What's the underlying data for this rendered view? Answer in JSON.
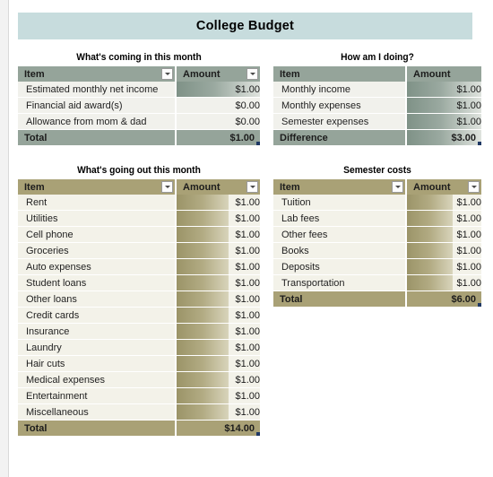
{
  "page": {
    "title": "College Budget",
    "theme_sage": "#95a49a",
    "theme_khaki": "#a9a176",
    "banner_color": "#c7dcdd"
  },
  "tables": {
    "incoming": {
      "heading": "What's coming in this month",
      "columns": [
        "Item",
        "Amount"
      ],
      "has_filters": true,
      "theme": "sage",
      "rows": [
        {
          "item": "Estimated monthly net income",
          "amount": "$1.00",
          "bar": 100
        },
        {
          "item": "Financial aid award(s)",
          "amount": "$0.00",
          "bar": 0
        },
        {
          "item": "Allowance from mom & dad",
          "amount": "$0.00",
          "bar": 0
        }
      ],
      "total_label": "Total",
      "total_amount": "$1.00"
    },
    "status": {
      "heading": "How am I doing?",
      "columns": [
        "Item",
        "Amount"
      ],
      "has_filters": false,
      "theme": "sage",
      "rows": [
        {
          "item": "Monthly income",
          "amount": "$1.00",
          "bar": 100
        },
        {
          "item": "Monthly expenses",
          "amount": "$1.00",
          "bar": 100
        },
        {
          "item": "Semester expenses",
          "amount": "$1.00",
          "bar": 100
        }
      ],
      "total_label": "Difference",
      "total_amount": "$3.00"
    },
    "outgoing": {
      "heading": "What's going out this month",
      "columns": [
        "Item",
        "Amount"
      ],
      "has_filters": true,
      "theme": "khaki",
      "rows": [
        {
          "item": "Rent",
          "amount": "$1.00",
          "bar": 62
        },
        {
          "item": "Utilities",
          "amount": "$1.00",
          "bar": 62
        },
        {
          "item": "Cell phone",
          "amount": "$1.00",
          "bar": 62
        },
        {
          "item": "Groceries",
          "amount": "$1.00",
          "bar": 62
        },
        {
          "item": "Auto expenses",
          "amount": "$1.00",
          "bar": 62
        },
        {
          "item": "Student loans",
          "amount": "$1.00",
          "bar": 62
        },
        {
          "item": "Other loans",
          "amount": "$1.00",
          "bar": 62
        },
        {
          "item": "Credit cards",
          "amount": "$1.00",
          "bar": 62
        },
        {
          "item": "Insurance",
          "amount": "$1.00",
          "bar": 62
        },
        {
          "item": "Laundry",
          "amount": "$1.00",
          "bar": 62
        },
        {
          "item": "Hair cuts",
          "amount": "$1.00",
          "bar": 62
        },
        {
          "item": "Medical expenses",
          "amount": "$1.00",
          "bar": 62
        },
        {
          "item": "Entertainment",
          "amount": "$1.00",
          "bar": 62
        },
        {
          "item": "Miscellaneous",
          "amount": "$1.00",
          "bar": 62
        }
      ],
      "total_label": "Total",
      "total_amount": "$14.00"
    },
    "semester": {
      "heading": "Semester costs",
      "columns": [
        "Item",
        "Amount"
      ],
      "has_filters": true,
      "theme": "khaki",
      "rows": [
        {
          "item": "Tuition",
          "amount": "$1.00",
          "bar": 62
        },
        {
          "item": "Lab fees",
          "amount": "$1.00",
          "bar": 62
        },
        {
          "item": "Other fees",
          "amount": "$1.00",
          "bar": 62
        },
        {
          "item": "Books",
          "amount": "$1.00",
          "bar": 62
        },
        {
          "item": "Deposits",
          "amount": "$1.00",
          "bar": 62
        },
        {
          "item": "Transportation",
          "amount": "$1.00",
          "bar": 62
        }
      ],
      "total_label": "Total",
      "total_amount": "$6.00"
    }
  }
}
